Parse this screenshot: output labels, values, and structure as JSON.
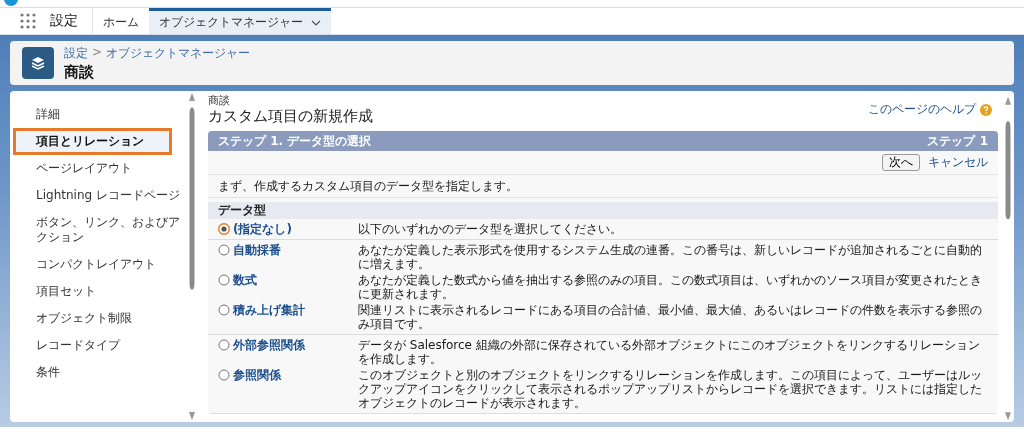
{
  "nav": {
    "app_name": "設定",
    "tabs": [
      {
        "label": "ホーム",
        "selected": false,
        "menu": false
      },
      {
        "label": "オブジェクトマネージャー",
        "selected": true,
        "menu": true
      }
    ]
  },
  "header": {
    "breadcrumb": [
      {
        "label": "設定"
      },
      {
        "label": "オブジェクトマネージャー"
      }
    ],
    "separator": ">",
    "title": "商談"
  },
  "sidebar": {
    "items": [
      {
        "label": "詳細",
        "selected": false,
        "highlighted": false
      },
      {
        "label": "項目とリレーション",
        "selected": true,
        "highlighted": true
      },
      {
        "label": "ページレイアウト",
        "selected": false,
        "highlighted": false
      },
      {
        "label": "Lightning レコードページ",
        "selected": false,
        "highlighted": false
      },
      {
        "label": "ボタン、リンク、およびアクション",
        "selected": false,
        "highlighted": false
      },
      {
        "label": "コンパクトレイアウト",
        "selected": false,
        "highlighted": false
      },
      {
        "label": "項目セット",
        "selected": false,
        "highlighted": false
      },
      {
        "label": "オブジェクト制限",
        "selected": false,
        "highlighted": false
      },
      {
        "label": "レコードタイプ",
        "selected": false,
        "highlighted": false
      },
      {
        "label": "条件",
        "selected": false,
        "highlighted": false
      }
    ]
  },
  "content": {
    "object": "商談",
    "title": "カスタム項目の新規作成",
    "help_link": "このページのヘルプ",
    "step": {
      "title": "ステップ 1. データ型の選択",
      "counter": "ステップ 1"
    },
    "buttons": [
      {
        "label": "次へ",
        "kind": "button"
      },
      {
        "label": "キャンセル",
        "kind": "link"
      }
    ],
    "intro": "まず、作成するカスタム項目のデータ型を指定します。",
    "section": "データ型",
    "groups": [
      {
        "options": [
          {
            "label": "(指定なし)",
            "selected": true,
            "description": "以下のいずれかのデータ型を選択してください。"
          }
        ]
      },
      {
        "options": [
          {
            "label": "自動採番",
            "selected": false,
            "description": "あなたが定義した表示形式を使用するシステム生成の連番。この番号は、新しいレコードが追加されるごとに自動的に増えます。"
          },
          {
            "label": "数式",
            "selected": false,
            "description": "あなたが定義した数式から値を抽出する参照のみの項目。この数式項目は、いずれかのソース項目が変更されたときに更新されます。"
          },
          {
            "label": "積み上げ集計",
            "selected": false,
            "description": "関連リストに表示されるレコードにある項目の合計値、最小値、最大値、あるいはレコードの件数を表示する参照のみ項目です。"
          }
        ]
      },
      {
        "options": [
          {
            "label": "外部参照関係",
            "selected": false,
            "description": "データが Salesforce 組織の外部に保存されている外部オブジェクトにこのオブジェクトをリンクするリレーションを作成します。"
          },
          {
            "label": "参照関係",
            "selected": false,
            "description": "このオブジェクトと別のオブジェクトをリンクするリレーションを作成します。この項目によって、ユーザーはルックアップアイコンをクリックして表示されるポップアップリストからレコードを選択できます。リストには指定したオブジェクトのレコードが表示されます。"
          }
        ]
      }
    ]
  }
}
